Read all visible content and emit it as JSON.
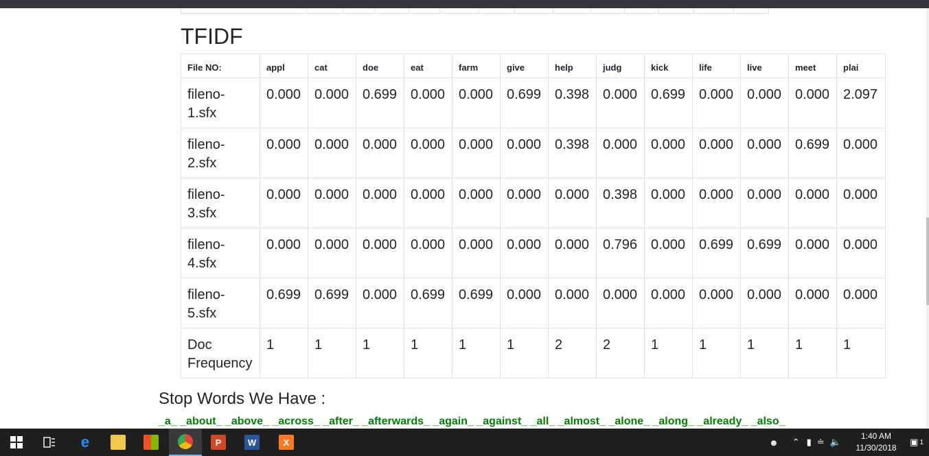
{
  "page": {
    "title": "TFIDF",
    "stop_title": "Stop Words We Have :",
    "stop_words": "_a_ _about_ _above_ _across_ _after_ _afterwards_ _again_ _against_ _all_ _almost_ _alone_ _along_ _already_ _also_"
  },
  "table": {
    "headers": [
      "File NO:",
      "appl",
      "cat",
      "doe",
      "eat",
      "farm",
      "give",
      "help",
      "judg",
      "kick",
      "life",
      "live",
      "meet",
      "plai"
    ],
    "rows": [
      [
        "fileno-1.sfx",
        "0.000",
        "0.000",
        "0.699",
        "0.000",
        "0.000",
        "0.699",
        "0.398",
        "0.000",
        "0.699",
        "0.000",
        "0.000",
        "0.000",
        "2.097"
      ],
      [
        "fileno-2.sfx",
        "0.000",
        "0.000",
        "0.000",
        "0.000",
        "0.000",
        "0.000",
        "0.398",
        "0.000",
        "0.000",
        "0.000",
        "0.000",
        "0.699",
        "0.000"
      ],
      [
        "fileno-3.sfx",
        "0.000",
        "0.000",
        "0.000",
        "0.000",
        "0.000",
        "0.000",
        "0.000",
        "0.398",
        "0.000",
        "0.000",
        "0.000",
        "0.000",
        "0.000"
      ],
      [
        "fileno-4.sfx",
        "0.000",
        "0.000",
        "0.000",
        "0.000",
        "0.000",
        "0.000",
        "0.000",
        "0.796",
        "0.000",
        "0.699",
        "0.699",
        "0.000",
        "0.000"
      ],
      [
        "fileno-5.sfx",
        "0.699",
        "0.699",
        "0.000",
        "0.699",
        "0.699",
        "0.000",
        "0.000",
        "0.000",
        "0.000",
        "0.000",
        "0.000",
        "0.000",
        "0.000"
      ],
      [
        "Doc Frequency",
        "1",
        "1",
        "1",
        "1",
        "1",
        "1",
        "2",
        "2",
        "1",
        "1",
        "1",
        "1",
        "1"
      ]
    ]
  },
  "taskbar": {
    "apps": [
      {
        "name": "start-button",
        "icon": "windows-logo-icon",
        "interactable": true
      },
      {
        "name": "task-view-button",
        "icon": "task-view-icon",
        "interactable": true
      },
      {
        "name": "edge-button",
        "icon": "edge-icon",
        "glyph": "e",
        "color": "#1e90ff"
      },
      {
        "name": "file-explorer-button",
        "icon": "folder-icon",
        "glyph": "",
        "color": "#f2c94c"
      },
      {
        "name": "store-button",
        "icon": "store-icon",
        "glyph": "",
        "color": "#ffffff"
      },
      {
        "name": "chrome-button",
        "icon": "chrome-icon",
        "glyph": "",
        "color": "#34a853",
        "active": true
      },
      {
        "name": "powerpoint-button",
        "icon": "powerpoint-icon",
        "glyph": "P",
        "color": "#d24726"
      },
      {
        "name": "word-button",
        "icon": "word-icon",
        "glyph": "W",
        "color": "#2b579a"
      },
      {
        "name": "xampp-button",
        "icon": "xampp-icon",
        "glyph": "X",
        "color": "#fb7a24"
      }
    ],
    "time": "1:40 AM",
    "date": "11/30/2018",
    "notification_count": "1"
  },
  "colors": {
    "stop_words": "#008000",
    "taskbar": "#1f1f1f",
    "top_bar": "#35363a",
    "table_border": "#dee2e6"
  }
}
